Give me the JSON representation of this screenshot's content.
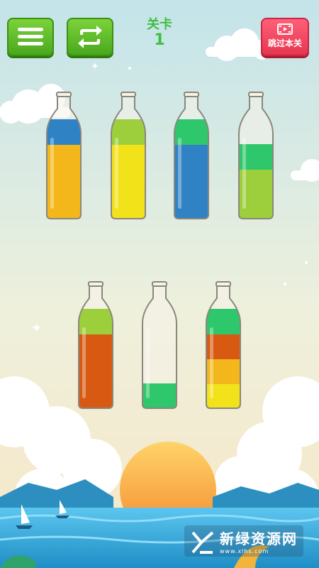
{
  "header": {
    "menu_icon": "hamburger-icon",
    "restart_icon": "restart-icon",
    "level_label": "关卡",
    "level_number": "1",
    "skip_label": "跳过本关",
    "skip_icon": "video-icon"
  },
  "colors": {
    "blue": "#2f82c4",
    "yellow_orange": "#f3b71b",
    "yellow": "#f2e21a",
    "lime": "#9dcf3c",
    "green": "#2fc76c",
    "orange_red": "#d85a12",
    "sky_top": "#c8e6ea",
    "sky_bottom": "#f6e9cc",
    "sea": "#2ea6d8",
    "sun": "#f7a63b"
  },
  "bottles": [
    {
      "layers": [
        "blue",
        "yellow_orange",
        "yellow_orange",
        "yellow_orange"
      ]
    },
    {
      "layers": [
        "lime",
        "yellow",
        "yellow",
        "yellow"
      ]
    },
    {
      "layers": [
        "green",
        "blue",
        "blue",
        "blue"
      ]
    },
    {
      "layers": [
        "green",
        "lime",
        "lime"
      ]
    },
    {
      "layers": [
        "lime",
        "orange_red",
        "orange_red",
        "orange_red"
      ]
    },
    {
      "layers": [
        "green"
      ]
    },
    {
      "layers": [
        "green",
        "orange_red",
        "yellow_orange",
        "yellow"
      ]
    }
  ],
  "watermark": {
    "logo": "xlhs-logo",
    "text": "新绿资源网",
    "url": "www.xlhs.com"
  }
}
